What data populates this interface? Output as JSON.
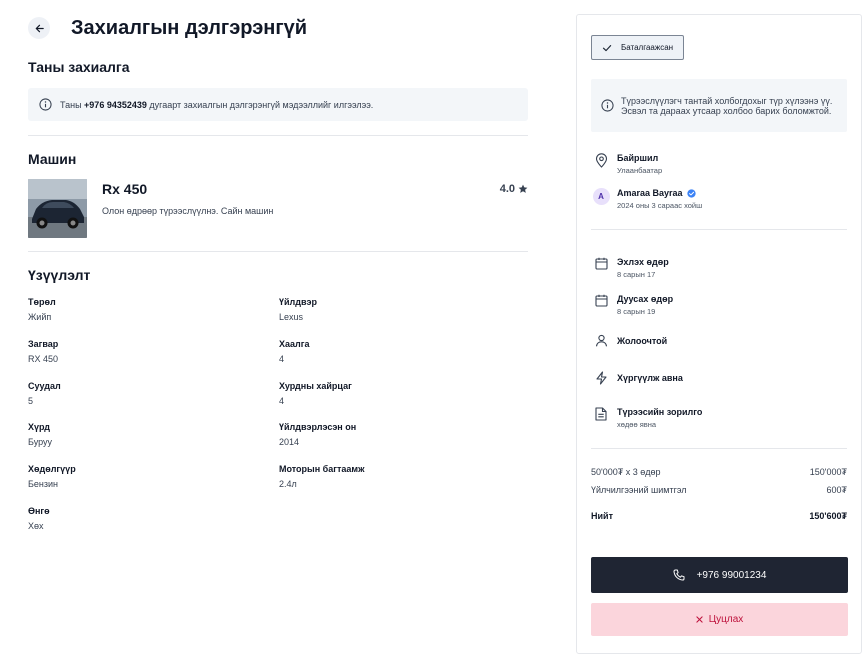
{
  "page": {
    "title": "Захиалгын дэлгэрэнгүй"
  },
  "order": {
    "section_title": "Таны захиалга",
    "notice_prefix": "Таны ",
    "notice_phone": "+976 94352439",
    "notice_suffix": " дугаарт захиалгын дэлгэрэнгүй мэдээллийг илгээлээ."
  },
  "car": {
    "section_title": "Машин",
    "name": "Rx 450",
    "rating": "4.0",
    "description": "Олон өдрөөр түрээслүүлнэ. Сайн машин"
  },
  "specs": {
    "section_title": "Үзүүлэлт",
    "items": [
      {
        "label": "Төрөл",
        "value": "Жийп"
      },
      {
        "label": "Үйлдвэр",
        "value": "Lexus"
      },
      {
        "label": "Загвар",
        "value": "RX 450"
      },
      {
        "label": "Хаалга",
        "value": "4"
      },
      {
        "label": "Суудал",
        "value": "5"
      },
      {
        "label": "Хурдны хайрцаг",
        "value": "4"
      },
      {
        "label": "Хүрд",
        "value": "Буруу"
      },
      {
        "label": "Үйлдвэрлэсэн он",
        "value": "2014"
      },
      {
        "label": "Хөдөлгүүр",
        "value": "Бензин"
      },
      {
        "label": "Моторын багтаамж",
        "value": "2.4л"
      },
      {
        "label": "Өнгө",
        "value": "Хөх"
      }
    ]
  },
  "panel": {
    "status": "Баталгаажсан",
    "info": "Түрээслүүлэгч тантай холбогдохыг түр хүлээнэ үү. Эсвэл та дараах утсаар холбоо барих боломжтой.",
    "location_title": "Байршил",
    "location_value": "Улаанбаатар",
    "avatar_letter": "A",
    "owner_name": "Amaraa Bayraa",
    "owner_since": "2024 оны 3 сараас хойш",
    "start_title": "Эхлэх өдөр",
    "start_value": "8 сарын 17",
    "end_title": "Дуусах өдөр",
    "end_value": "8 сарын 19",
    "driver": "Жолоочтой",
    "delivery": "Хүргүүлж авна",
    "purpose_title": "Түрээсийн зорилго",
    "purpose_value": "хөдөө явна",
    "price_line_label": "50'000₮ x 3 өдөр",
    "price_line_value": "150'000₮",
    "fee_label": "Үйлчилгээний шимтгэл",
    "fee_value": "600₮",
    "total_label": "Нийт",
    "total_value": "150'600₮",
    "call_label": "+976 99001234",
    "cancel_label": "Цуцлах"
  },
  "colors": {
    "primary_dark": "#1f2533",
    "cancel_bg": "#fbd5dc",
    "cancel_text": "#be123c",
    "verified_blue": "#3b82f6"
  },
  "icons": [
    "back-arrow-icon",
    "info-icon",
    "star-icon",
    "check-icon",
    "location-pin-icon",
    "verified-badge-icon",
    "calendar-icon",
    "user-icon",
    "lightning-icon",
    "document-icon",
    "phone-icon",
    "close-icon"
  ]
}
